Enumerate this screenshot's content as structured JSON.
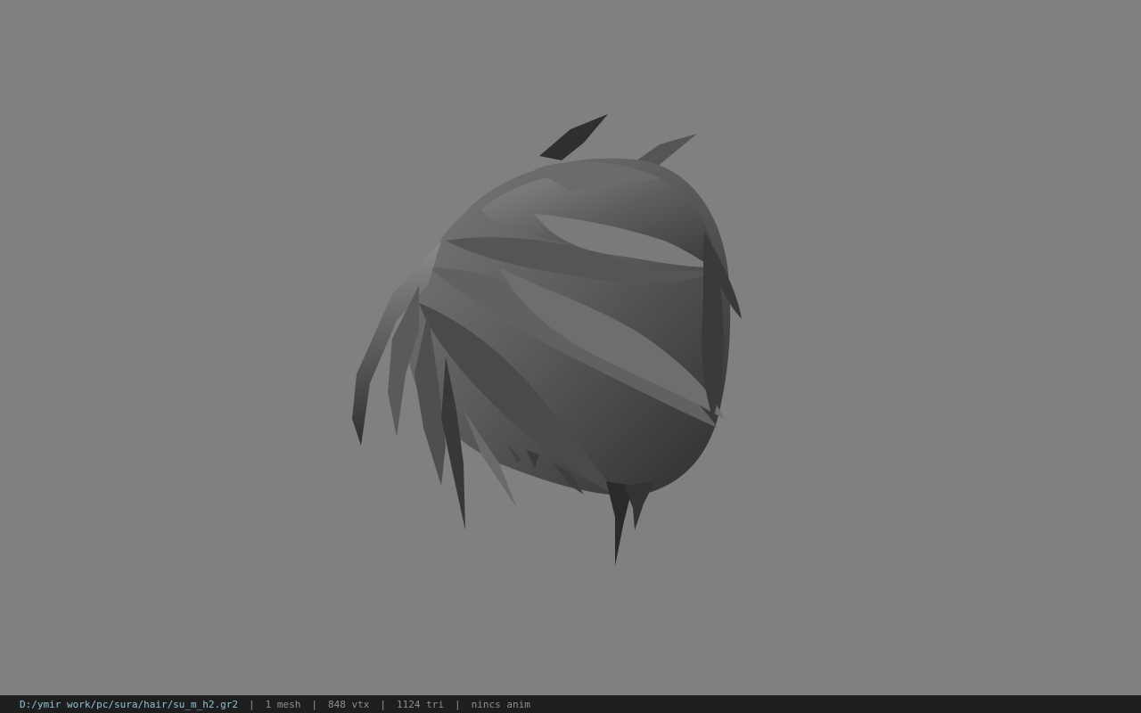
{
  "viewport": {
    "background_color": "#808080",
    "model_name": "hair-mesh"
  },
  "status": {
    "file_path": "D:/ymir work/pc/sura/hair/su_m_h2.gr2",
    "separator": "|",
    "mesh_count": "1 mesh",
    "vertex_count": "848 vtx",
    "triangle_count": "1124 tri",
    "anim_status": "nincs anim"
  }
}
